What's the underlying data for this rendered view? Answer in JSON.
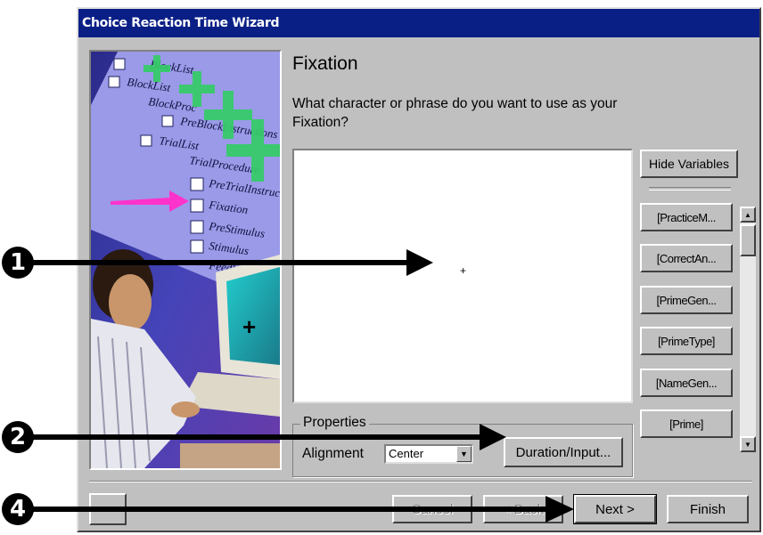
{
  "window": {
    "title": "Choice Reaction Time Wizard"
  },
  "illustration": {
    "tree_items": [
      "BlockList",
      "BlockList",
      "BlockProc",
      "PreBlockInstructions",
      "TrialList",
      "TrialProcedure",
      "PreTrialInstruction",
      "Fixation",
      "PreStimulus",
      "Stimulus",
      "Feedback"
    ],
    "monitor_symbol": "+",
    "accent_colors": {
      "tree_bg": "#8080e8",
      "plus": "#33cc66",
      "pointer": "#ff33cc"
    }
  },
  "step": {
    "title": "Fixation",
    "question": "What character or phrase do you want to use as your Fixation?"
  },
  "editor": {
    "value": "+"
  },
  "variables": {
    "hide_label": "Hide Variables",
    "items": [
      "[PracticeM...",
      "[CorrectAn...",
      "[PrimeGen...",
      "[PrimeType]",
      "[NameGen...",
      "[Prime]"
    ]
  },
  "properties": {
    "legend": "Properties",
    "alignment_label": "Alignment",
    "alignment_value": "Center",
    "duration_button": "Duration/Input..."
  },
  "footer": {
    "cancel": "Cancel",
    "back": "< Back",
    "next": "Next >",
    "finish": "Finish"
  },
  "annotations": [
    "1",
    "2",
    "4"
  ]
}
